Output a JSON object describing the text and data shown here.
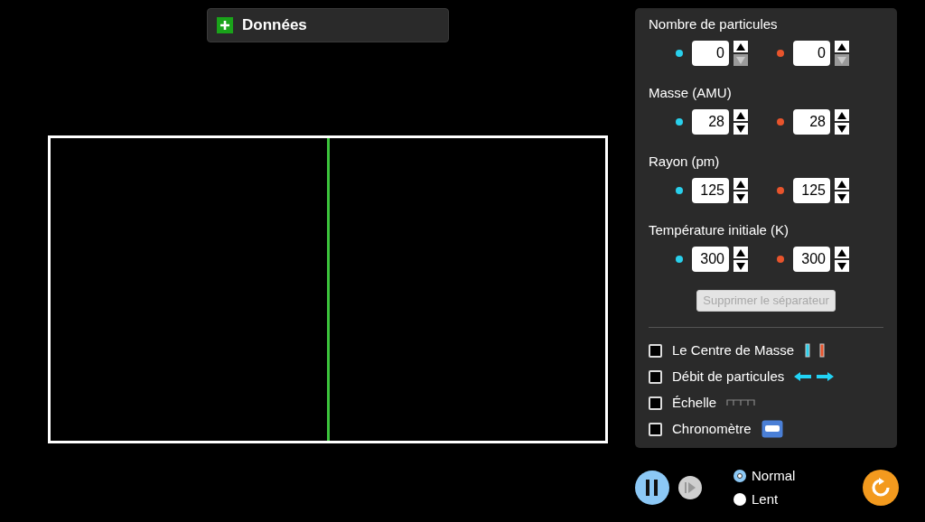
{
  "data_panel": {
    "title": "Données",
    "expanded": false
  },
  "container": {
    "divider": true
  },
  "settings": [
    {
      "label": "Nombre de particules",
      "fields": [
        {
          "color": "#29d0ec",
          "value": "0",
          "down_disabled": true
        },
        {
          "color": "#e8542c",
          "value": "0",
          "down_disabled": true
        }
      ]
    },
    {
      "label": "Masse (AMU)",
      "fields": [
        {
          "color": "#29d0ec",
          "value": "28",
          "down_disabled": false
        },
        {
          "color": "#e8542c",
          "value": "28",
          "down_disabled": false
        }
      ]
    },
    {
      "label": "Rayon (pm)",
      "fields": [
        {
          "color": "#29d0ec",
          "value": "125",
          "down_disabled": false
        },
        {
          "color": "#e8542c",
          "value": "125",
          "down_disabled": false
        }
      ]
    },
    {
      "label": "Température initiale (K)",
      "fields": [
        {
          "color": "#29d0ec",
          "value": "300",
          "down_disabled": false
        },
        {
          "color": "#e8542c",
          "value": "300",
          "down_disabled": false
        }
      ]
    }
  ],
  "remove_button": {
    "label": "Supprimer le séparateur",
    "disabled": true
  },
  "options": [
    {
      "kind": "center_of_mass",
      "label": "Le Centre de Masse",
      "checked": false
    },
    {
      "kind": "flux",
      "label": "Débit de particules",
      "checked": false
    },
    {
      "kind": "ruler",
      "label": "Échelle",
      "checked": false
    },
    {
      "kind": "stopwatch",
      "label": "Chronomètre",
      "checked": false
    }
  ],
  "playback": {
    "playing": true,
    "step_disabled": true
  },
  "speeds": [
    {
      "label": "Normal",
      "selected": true
    },
    {
      "label": "Lent",
      "selected": false
    }
  ]
}
